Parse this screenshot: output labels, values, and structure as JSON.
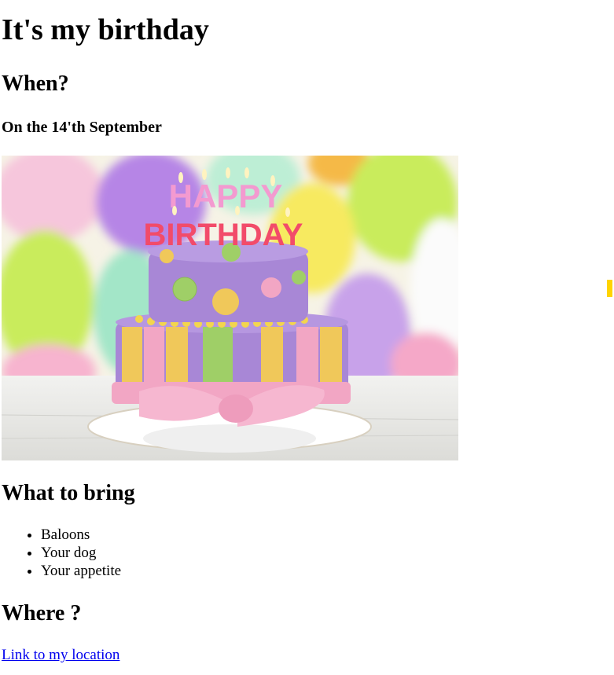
{
  "page": {
    "title": "It's my birthday",
    "when_heading": "When?",
    "date_text": "On the 14'th September",
    "cake_image": {
      "banner_line1": "HAPPY",
      "banner_line2": "BIRTHDAY",
      "colors": {
        "balloon_purple": "#b685e6",
        "balloon_green": "#c9ec5c",
        "balloon_pink": "#f6bcd3",
        "balloon_yellow": "#f7ea61",
        "cake_purple": "#a887d6",
        "ribbon_pink": "#f2a6c4",
        "stripe_yellow": "#f0c85a",
        "stripe_green": "#9fcf67"
      }
    },
    "bring_heading": "What to bring",
    "bring_items": [
      "Baloons",
      "Your dog",
      "Your appetite"
    ],
    "where_heading": "Where ?",
    "location_link": "Link to my location",
    "accent_marker_color": "#ffd400"
  }
}
